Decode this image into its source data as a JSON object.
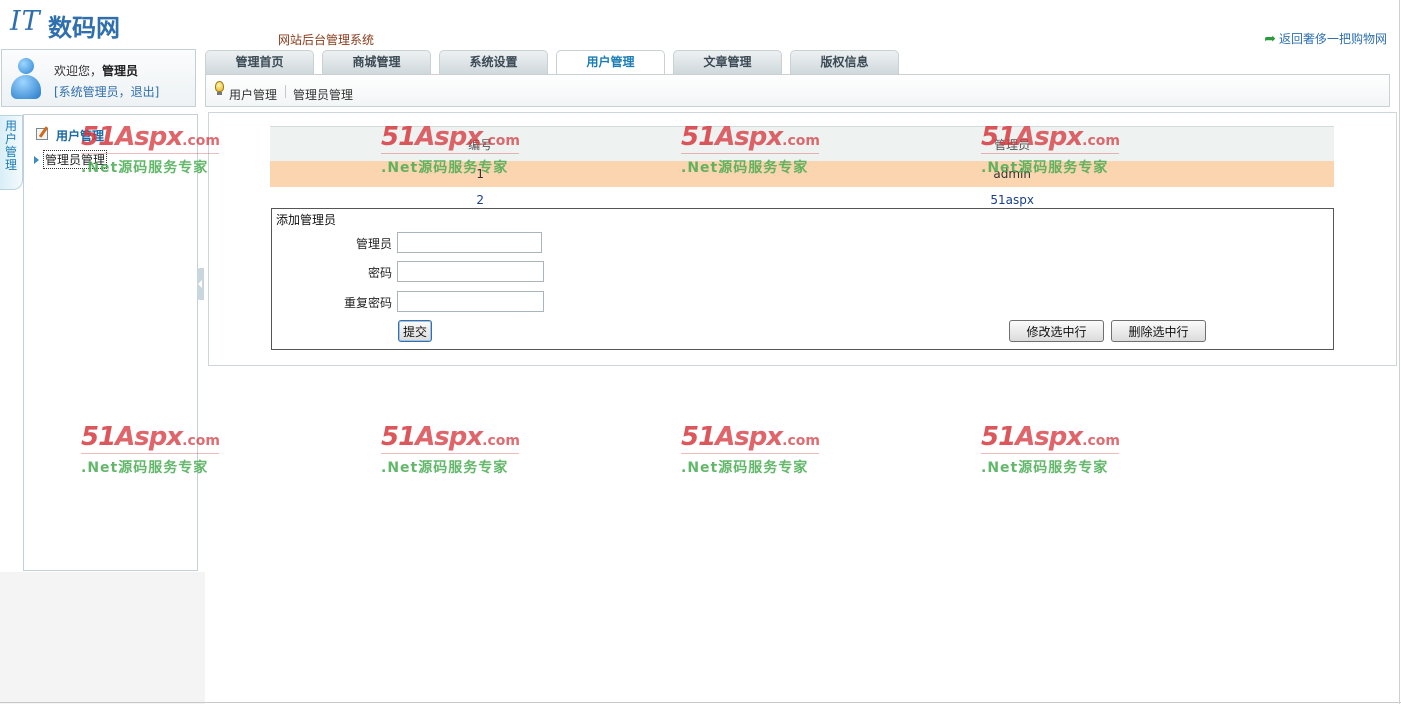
{
  "header": {
    "logo_it": "IT",
    "logo_cn": "数码网",
    "system_title": "网站后台管理系统",
    "back_link": "返回奢侈一把购物网"
  },
  "welcome": {
    "greeting": "欢迎您，",
    "user": "管理员",
    "role_links": "[系统管理员，退出]"
  },
  "tabs": [
    {
      "label": "管理首页"
    },
    {
      "label": "商城管理"
    },
    {
      "label": "系统设置"
    },
    {
      "label": "用户管理",
      "active": true
    },
    {
      "label": "文章管理"
    },
    {
      "label": "版权信息"
    }
  ],
  "breadcrumb": [
    "用户管理",
    "管理员管理"
  ],
  "sidebar": {
    "vertical_tab": "用户管理",
    "section_title": "用户管理",
    "items": [
      "管理员管理"
    ]
  },
  "admin_table": {
    "columns": [
      "编号",
      "管理员"
    ],
    "rows": [
      {
        "id": "1",
        "name": "admin",
        "selected": true
      },
      {
        "id": "2",
        "name": "51aspx",
        "selected": false
      }
    ]
  },
  "add_form": {
    "title": "添加管理员",
    "fields": [
      {
        "label": "管理员",
        "value": ""
      },
      {
        "label": "密码",
        "value": ""
      },
      {
        "label": "重复密码",
        "value": ""
      }
    ],
    "submit_label": "提交",
    "edit_label": "修改选中行",
    "delete_label": "删除选中行"
  },
  "watermark": {
    "brand_num": "51",
    "brand_text": "Aspx",
    "brand_domain": ".com",
    "slogan": ".Net源码服务专家"
  },
  "colors": {
    "accent": "#1a7db5",
    "selected_row": "#fbd5b0",
    "watermark_red": "#d63a40",
    "watermark_green": "#46aa50"
  }
}
